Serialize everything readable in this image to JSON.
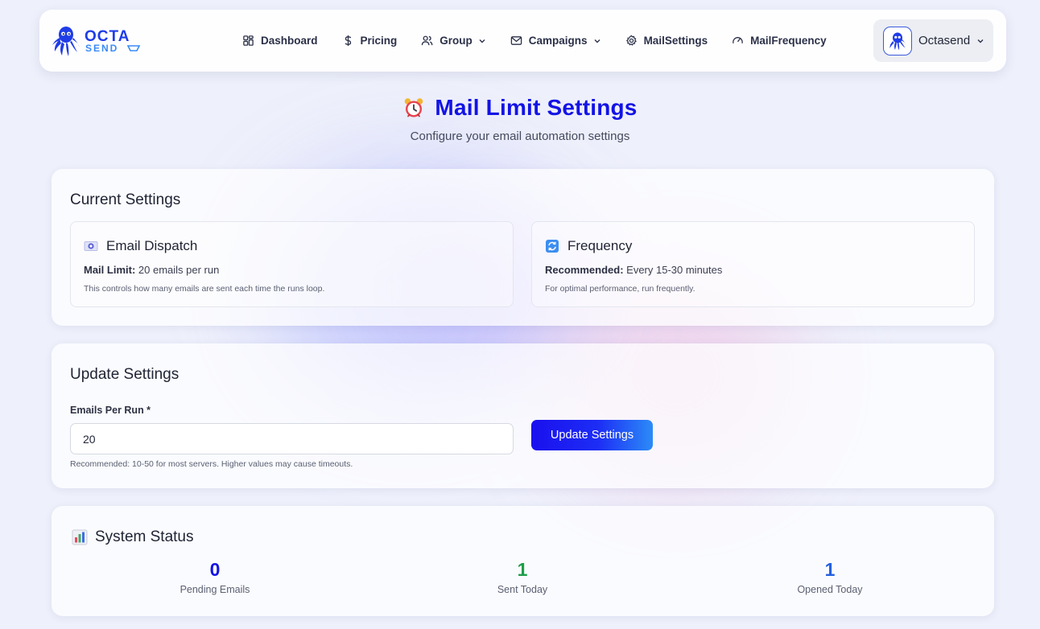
{
  "colors": {
    "brand_blue": "#1313e6",
    "sent_green": "#1e9e4a",
    "opened_blue": "#2461e0",
    "button_gradient_start": "#1a10ee",
    "button_gradient_end": "#2b8cf7"
  },
  "logo": {
    "top_text": "OCTA",
    "bottom_text": "SEND",
    "icon": "octopus-logo-icon"
  },
  "nav": {
    "items": [
      {
        "label": "Dashboard",
        "icon": "grid-icon"
      },
      {
        "label": "Pricing",
        "icon": "dollar-icon"
      },
      {
        "label": "Group",
        "icon": "users-icon",
        "dropdown": true
      },
      {
        "label": "Campaigns",
        "icon": "mail-icon",
        "dropdown": true
      },
      {
        "label": "MailSettings",
        "icon": "gear-icon"
      },
      {
        "label": "MailFrequency",
        "icon": "gauge-icon"
      }
    ],
    "user": {
      "name": "Octasend",
      "avatar": "octopus-avatar-icon"
    }
  },
  "header": {
    "title": "Mail Limit Settings",
    "subtitle": "Configure your email automation settings",
    "icon": "alarm-clock-icon"
  },
  "current_settings": {
    "title": "Current Settings",
    "email_dispatch": {
      "title": "Email Dispatch",
      "icon": "email-chip-icon",
      "key": "Mail Limit:",
      "value": " 20 emails per run",
      "note": "This controls how many emails are sent each time the runs loop."
    },
    "frequency": {
      "title": "Frequency",
      "icon": "refresh-icon",
      "key": "Recommended:",
      "value": " Every 15-30 minutes",
      "note": "For optimal performance, run frequently."
    }
  },
  "update_settings": {
    "title": "Update Settings",
    "field_label": "Emails Per Run *",
    "field_value": "20",
    "hint": "Recommended: 10-50 for most servers. Higher values may cause timeouts.",
    "button_label": "Update Settings"
  },
  "system_status": {
    "title": "System Status",
    "icon": "bar-chart-icon",
    "pending": {
      "value": "0",
      "label": "Pending Emails"
    },
    "sent": {
      "value": "1",
      "label": "Sent Today"
    },
    "opened": {
      "value": "1",
      "label": "Opened Today"
    }
  }
}
